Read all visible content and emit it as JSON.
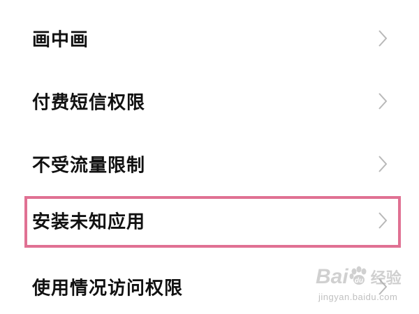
{
  "settings_list": {
    "items": [
      {
        "label": "画中画",
        "icon": "chevron-right-icon",
        "highlighted": false
      },
      {
        "label": "付费短信权限",
        "icon": "chevron-right-icon",
        "highlighted": false
      },
      {
        "label": "不受流量限制",
        "icon": "chevron-right-icon",
        "highlighted": false
      },
      {
        "label": "安装未知应用",
        "icon": "chevron-right-icon",
        "highlighted": true
      },
      {
        "label": "使用情况访问权限",
        "icon": "chevron-right-icon",
        "highlighted": false
      }
    ]
  },
  "highlight": {
    "color": "#e07193"
  },
  "watermark": {
    "logo_text_left": "Bai",
    "logo_text_right": "经验",
    "url": "jingyan.baidu.com"
  },
  "colors": {
    "background": "#ffffff",
    "text": "#111111",
    "chevron": "#b8b8b8"
  }
}
